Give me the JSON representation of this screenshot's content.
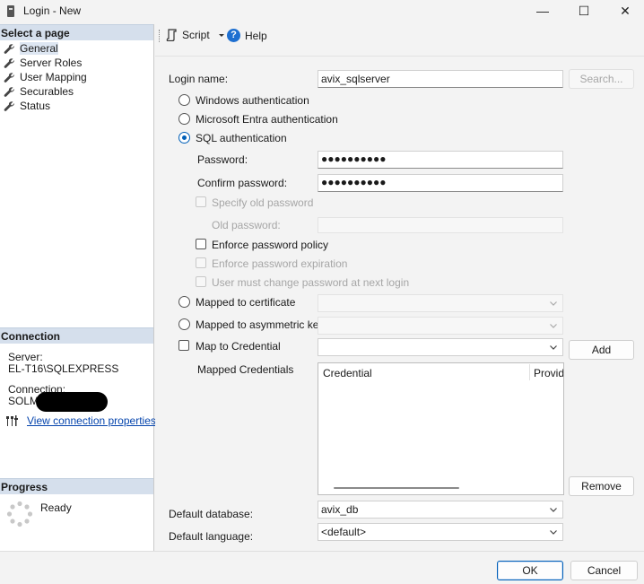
{
  "window": {
    "title": "Login - New",
    "minimize": "—",
    "maximize": "☐",
    "close": "✕"
  },
  "sidebar": {
    "select_page_header": "Select a page",
    "pages": [
      {
        "label": "General",
        "selected": true
      },
      {
        "label": "Server Roles"
      },
      {
        "label": "User Mapping"
      },
      {
        "label": "Securables"
      },
      {
        "label": "Status"
      }
    ],
    "connection_header": "Connection",
    "server_label": "Server:",
    "server_value": "EL-T16\\SQLEXPRESS",
    "connection_label": "Connection:",
    "connection_value": "SOLM",
    "view_connection_link": "View connection properties",
    "progress_header": "Progress",
    "progress_status": "Ready"
  },
  "toolbar": {
    "script_label": "Script",
    "help_label": "Help"
  },
  "form": {
    "login_name_label": "Login name:",
    "login_name_value": "avix_sqlserver",
    "search_button": "Search...",
    "windows_auth": "Windows authentication",
    "entra_auth": "Microsoft Entra authentication",
    "sql_auth": "SQL authentication",
    "password_label": "Password:",
    "password_value": "●●●●●●●●●●",
    "confirm_password_label": "Confirm password:",
    "confirm_password_value": "●●●●●●●●●●",
    "specify_old_password": "Specify old password",
    "old_password_label": "Old password:",
    "enforce_policy": "Enforce password policy",
    "enforce_expiration": "Enforce password expiration",
    "must_change": "User must change password at next login",
    "mapped_certificate": "Mapped to certificate",
    "mapped_asym_key": "Mapped to asymmetric key",
    "map_credential": "Map to Credential",
    "add_button": "Add",
    "mapped_credentials_label": "Mapped Credentials",
    "credentials_columns": [
      "Credential",
      "Provide"
    ],
    "remove_button": "Remove",
    "default_database_label": "Default database:",
    "default_database_value": "avix_db",
    "default_language_label": "Default language:",
    "default_language_value": "<default>"
  },
  "footer": {
    "ok_button": "OK",
    "cancel_button": "Cancel"
  },
  "colors": {
    "accent": "#005fb8",
    "section_header": "#d5dfec",
    "link": "#0645ad"
  }
}
